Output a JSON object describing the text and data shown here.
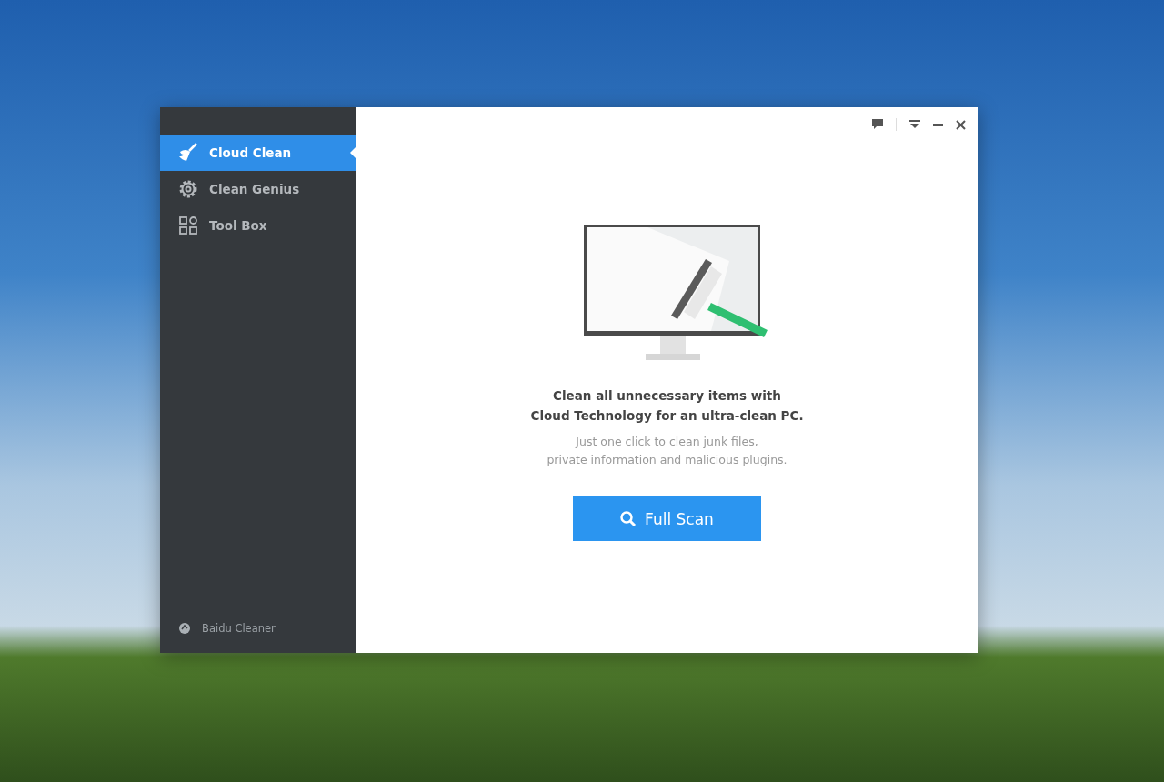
{
  "sidebar": {
    "items": [
      {
        "label": "Cloud Clean",
        "selected": true
      },
      {
        "label": "Clean Genius",
        "selected": false
      },
      {
        "label": "Tool Box",
        "selected": false
      }
    ],
    "footer": "Baidu Cleaner"
  },
  "main": {
    "headline": [
      "Clean all unnecessary items with",
      "Cloud Technology for an ultra-clean PC."
    ],
    "subtext": [
      "Just one click to clean junk files,",
      "private information and malicious plugins."
    ],
    "button": "Full Scan"
  }
}
